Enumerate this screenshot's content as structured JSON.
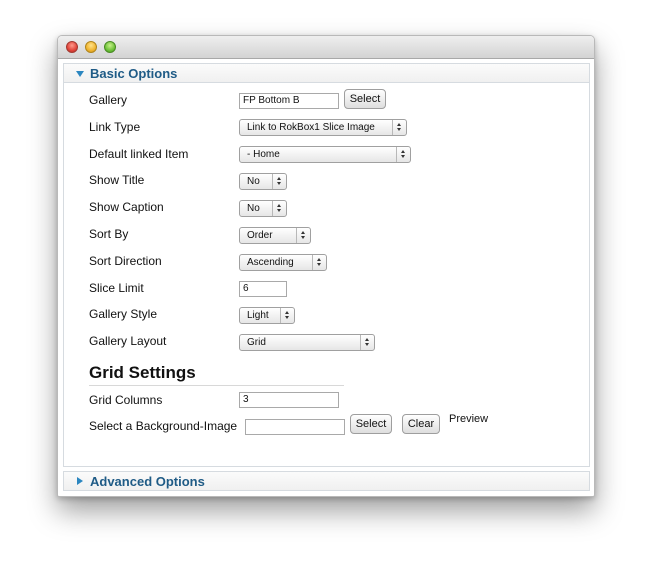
{
  "basic_options": {
    "header": "Basic Options",
    "fields": {
      "gallery": {
        "label": "Gallery",
        "value": "FP Bottom B",
        "select_button": "Select"
      },
      "link_type": {
        "label": "Link Type",
        "value": "Link to RokBox1 Slice Image"
      },
      "default_linked_item": {
        "label": "Default linked Item",
        "value": "- Home"
      },
      "show_title": {
        "label": "Show Title",
        "value": "No"
      },
      "show_caption": {
        "label": "Show Caption",
        "value": "No"
      },
      "sort_by": {
        "label": "Sort By",
        "value": "Order"
      },
      "sort_direction": {
        "label": "Sort Direction",
        "value": "Ascending"
      },
      "slice_limit": {
        "label": "Slice Limit",
        "value": "6"
      },
      "gallery_style": {
        "label": "Gallery Style",
        "value": "Light"
      },
      "gallery_layout": {
        "label": "Gallery Layout",
        "value": "Grid"
      }
    }
  },
  "grid_settings": {
    "title": "Grid Settings",
    "grid_columns": {
      "label": "Grid Columns",
      "value": "3"
    },
    "background_image": {
      "label": "Select a Background-Image",
      "value": "",
      "select_button": "Select",
      "clear_button": "Clear",
      "preview_label": "Preview"
    }
  },
  "advanced_options": {
    "header": "Advanced Options"
  },
  "colors": {
    "header_text": "#1f5b86",
    "triangle": "#2b86c0"
  },
  "icons": [
    "close-icon",
    "minimize-icon",
    "zoom-icon",
    "expanded-triangle-icon",
    "collapsed-triangle-icon",
    "select-arrows-icon"
  ]
}
